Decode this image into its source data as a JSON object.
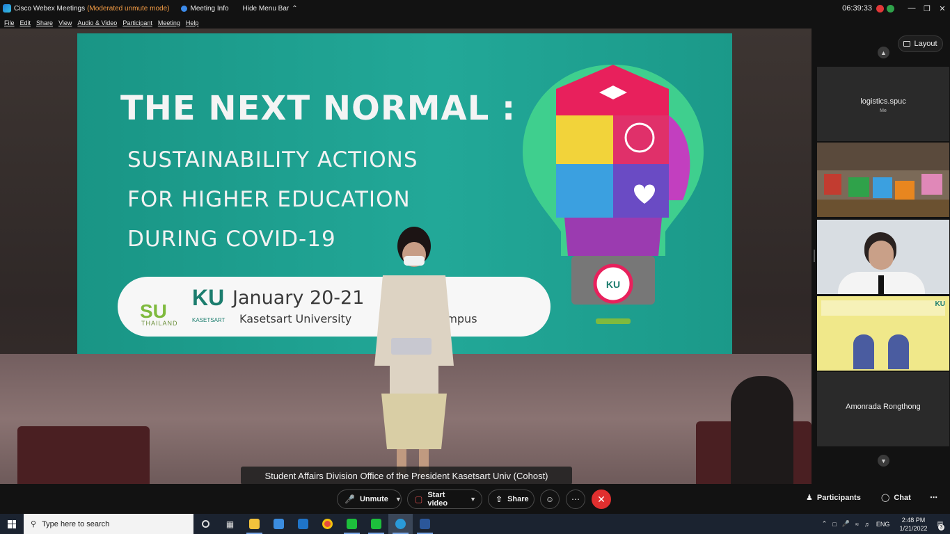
{
  "titlebar": {
    "app_title": "Cisco Webex Meetings",
    "mode": "(Moderated unmute mode)",
    "meeting_info": "Meeting Info",
    "hide_menu_bar": "Hide Menu Bar",
    "clock": "06:39:33"
  },
  "menu": [
    "File",
    "Edit",
    "Share",
    "View",
    "Audio & Video",
    "Participant",
    "Meeting",
    "Help"
  ],
  "slide": {
    "title": "THE NEXT NORMAL :",
    "line1": "SUSTAINABILITY ACTIONS",
    "line2": "FOR HIGHER EDUCATION",
    "line3": "DURING COVID-19",
    "su_logo": "SU",
    "su_sub": "THAILAND",
    "ku_logo": "KU",
    "ku_sub": "KASETSART",
    "date_text": "January 20-21",
    "campus_text": "Kasetsart University",
    "campus_tail": "en Campus",
    "bulb_badge": "KU"
  },
  "active_speaker": "Student Affairs Division Office of the President Kasetsart Univ (Cohost)",
  "panel": {
    "layout_label": "Layout",
    "tiles": [
      {
        "name": "logistics.spuc",
        "sub": "Me"
      },
      {
        "name": "",
        "sub": ""
      },
      {
        "name": "",
        "sub": ""
      },
      {
        "name": "",
        "sub": "",
        "banner_logo": "KU"
      },
      {
        "name": "Amonrada Rongthong",
        "sub": ""
      }
    ]
  },
  "controls": {
    "unmute": "Unmute",
    "start_video": "Start video",
    "share": "Share",
    "participants": "Participants",
    "chat": "Chat"
  },
  "taskbar": {
    "search_placeholder": "Type here to search",
    "lang": "ENG",
    "time": "2:48 PM",
    "date": "1/21/2022",
    "notif_count": "3"
  },
  "colors": {
    "slide_bg": "#1f9e8e",
    "end_button": "#e02f2f",
    "mode_text": "#f39c45"
  }
}
